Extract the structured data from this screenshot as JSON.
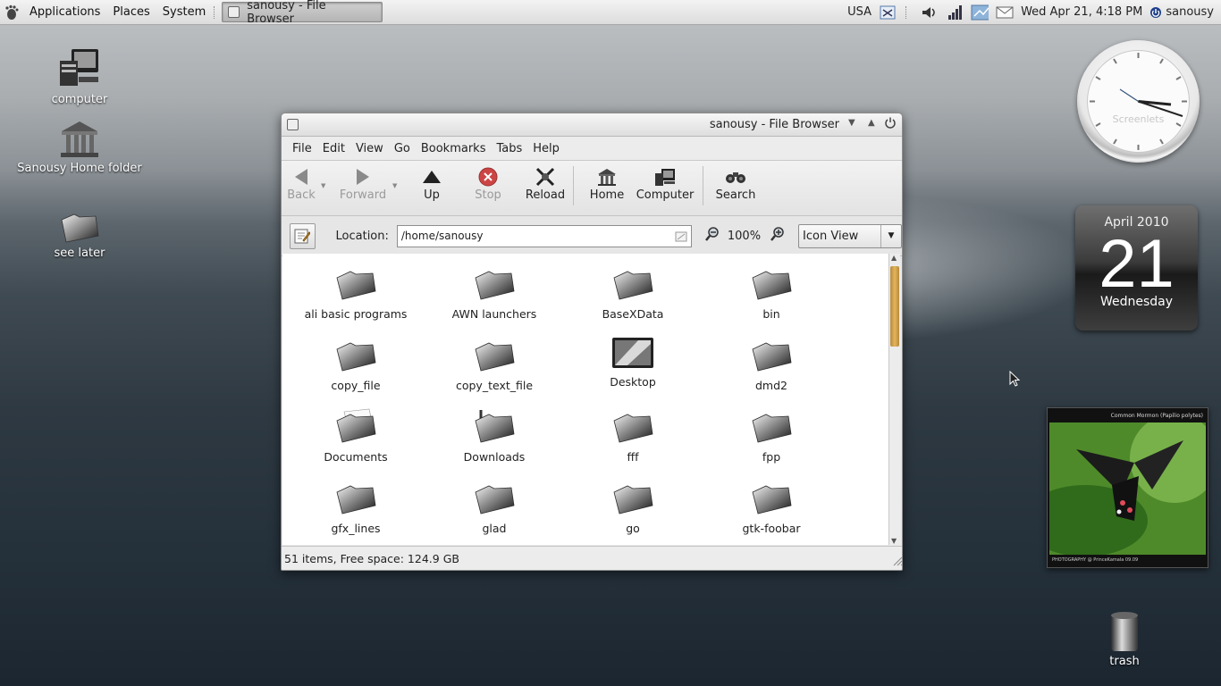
{
  "panel": {
    "menus": [
      "Applications",
      "Places",
      "System"
    ],
    "task_title": "sanousy - File Browser",
    "keyboard": "USA",
    "clock_text": "Wed Apr 21,  4:18 PM",
    "user": "sanousy"
  },
  "desktop": {
    "icons": [
      {
        "label": "computer",
        "icon": "computer-icon"
      },
      {
        "label": "Sanousy  Home  folder",
        "icon": "home-folder-icon"
      },
      {
        "label": "see  later",
        "icon": "folder-icon"
      },
      {
        "label": "trash",
        "icon": "trash-icon"
      }
    ]
  },
  "window": {
    "title": "sanousy - File Browser",
    "menus": [
      "File",
      "Edit",
      "View",
      "Go",
      "Bookmarks",
      "Tabs",
      "Help"
    ],
    "toolbar": {
      "back": "Back",
      "forward": "Forward",
      "up": "Up",
      "stop": "Stop",
      "reload": "Reload",
      "home": "Home",
      "computer": "Computer",
      "search": "Search"
    },
    "location_label": "Location:",
    "location_value": "/home/sanousy",
    "zoom": "100%",
    "view_mode": "Icon View",
    "files": [
      {
        "name": "ali  basic  programs",
        "icon": "folder-icon"
      },
      {
        "name": "AWN  launchers",
        "icon": "folder-icon"
      },
      {
        "name": "BaseXData",
        "icon": "folder-icon"
      },
      {
        "name": "bin",
        "icon": "folder-icon"
      },
      {
        "name": "copy_file",
        "icon": "folder-icon"
      },
      {
        "name": "copy_text_file",
        "icon": "folder-icon"
      },
      {
        "name": "Desktop",
        "icon": "desktop-icon"
      },
      {
        "name": "dmd2",
        "icon": "folder-icon"
      },
      {
        "name": "Documents",
        "icon": "documents-folder-icon"
      },
      {
        "name": "Downloads",
        "icon": "downloads-folder-icon"
      },
      {
        "name": "fff",
        "icon": "folder-icon"
      },
      {
        "name": "fpp",
        "icon": "folder-icon"
      },
      {
        "name": "gfx_lines",
        "icon": "folder-icon"
      },
      {
        "name": "glad",
        "icon": "folder-icon"
      },
      {
        "name": "go",
        "icon": "folder-icon"
      },
      {
        "name": "gtk-foobar",
        "icon": "folder-icon"
      }
    ],
    "status": "51  items,  Free  space:  124.9  GB"
  },
  "widgets": {
    "clock_watermark": "Screenlets",
    "calendar": {
      "month": "April 2010",
      "day": "21",
      "weekday": "Wednesday"
    },
    "photo_caption_top": "Common Mormon (Papilio polytes)",
    "photo_caption_bottom": "PHOTOGRAPHY @ PrinceKamala 09.09"
  }
}
